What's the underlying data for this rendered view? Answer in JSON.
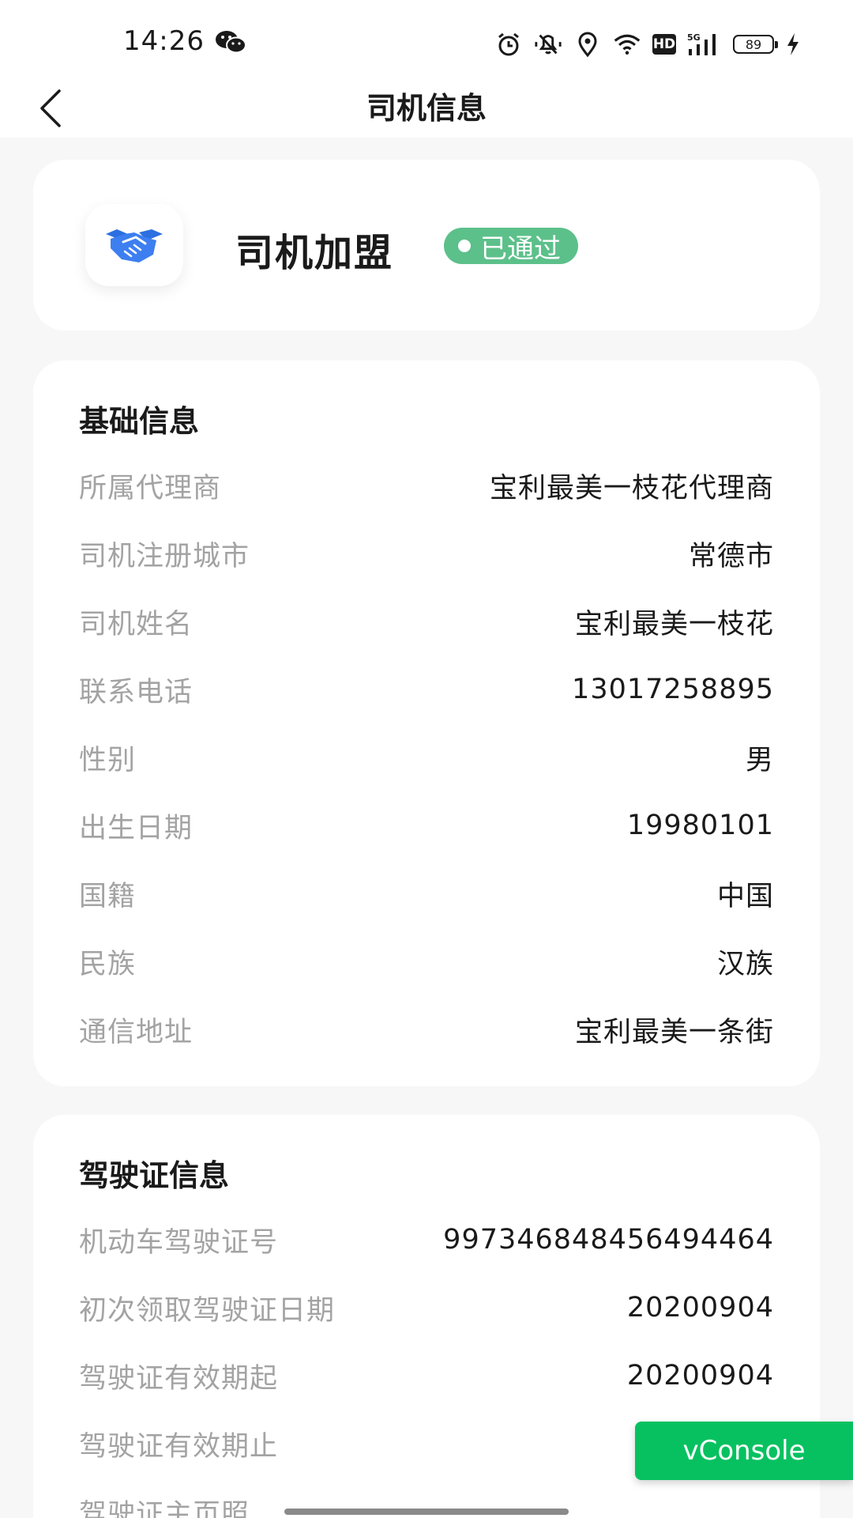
{
  "status_bar": {
    "time": "14:26",
    "network": "5G",
    "hd_label": "HD",
    "battery": "89"
  },
  "nav": {
    "title": "司机信息"
  },
  "status_card": {
    "title": "司机加盟",
    "badge": "已通过",
    "badge_color": "#5cc08a",
    "icon": "handshake-icon"
  },
  "basic_info": {
    "title": "基础信息",
    "rows": [
      {
        "label": "所属代理商",
        "value": "宝利最美一枝花代理商"
      },
      {
        "label": "司机注册城市",
        "value": "常德市"
      },
      {
        "label": "司机姓名",
        "value": "宝利最美一枝花"
      },
      {
        "label": "联系电话",
        "value": "13017258895"
      },
      {
        "label": "性别",
        "value": "男"
      },
      {
        "label": "出生日期",
        "value": "19980101"
      },
      {
        "label": "国籍",
        "value": "中国"
      },
      {
        "label": "民族",
        "value": "汉族"
      },
      {
        "label": "通信地址",
        "value": "宝利最美一条街"
      }
    ]
  },
  "license_info": {
    "title": "驾驶证信息",
    "rows": [
      {
        "label": "机动车驾驶证号",
        "value": "997346848456494464"
      },
      {
        "label": "初次领取驾驶证日期",
        "value": "20200904"
      },
      {
        "label": "驾驶证有效期起",
        "value": "20200904"
      },
      {
        "label": "驾驶证有效期止",
        "value": ""
      },
      {
        "label": "驾驶证主页照",
        "value": ""
      }
    ]
  },
  "vconsole": {
    "label": "vConsole",
    "color": "#07c160"
  }
}
